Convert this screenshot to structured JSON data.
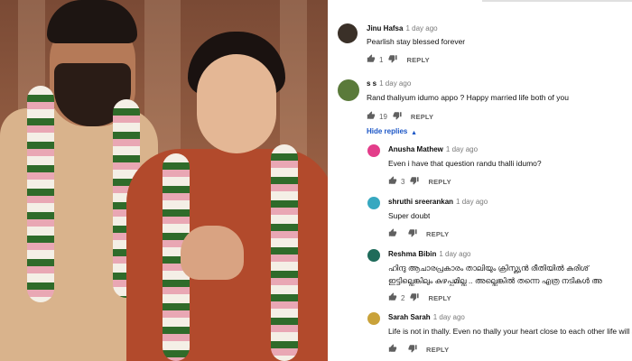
{
  "comments": [
    {
      "author": "Jinu Hafsa",
      "time": "1 day ago",
      "text": "Pearlish stay blessed forever",
      "likes": "1",
      "reply": "REPLY",
      "avatar_color": "#3a3028"
    },
    {
      "author": "s s",
      "time": "1 day ago",
      "text": "Rand thaliyum idumo appo ? Happy married life both of you",
      "likes": "19",
      "reply": "REPLY",
      "avatar_color": "#5a7a3a"
    }
  ],
  "hide_replies": "Hide replies",
  "replies": [
    {
      "author": "Anusha Mathew",
      "time": "1 day ago",
      "text": "Even i have that question randu thalli idumo?",
      "likes": "3",
      "reply": "REPLY",
      "avatar_color": "#e33d8a"
    },
    {
      "author": "shruthi sreerankan",
      "time": "1 day ago",
      "text": "Super doubt",
      "likes": "",
      "reply": "REPLY",
      "avatar_color": "#37a8c0"
    },
    {
      "author": "Reshma Bibin",
      "time": "1 day ago",
      "text": "ഹിന്ദു ആചാരപ്രകാരം താലിയും ക്രിസ്ത്യൻ രീതിയിൽ കുരിശ്",
      "text2": "ഇട്ടില്ലെങ്കിലും കുഴപ്പമില്ല .. അല്ലെങ്കിൽ തന്നെ എത്ര നടികൾ അ",
      "likes": "2",
      "reply": "REPLY",
      "avatar_color": "#1f6b5a"
    },
    {
      "author": "Sarah Sarah",
      "time": "1 day ago",
      "text": "Life is not in thally. Even no thally your heart close to each other life will s",
      "likes": "",
      "reply": "REPLY",
      "avatar_color": "#c9a23a"
    }
  ]
}
